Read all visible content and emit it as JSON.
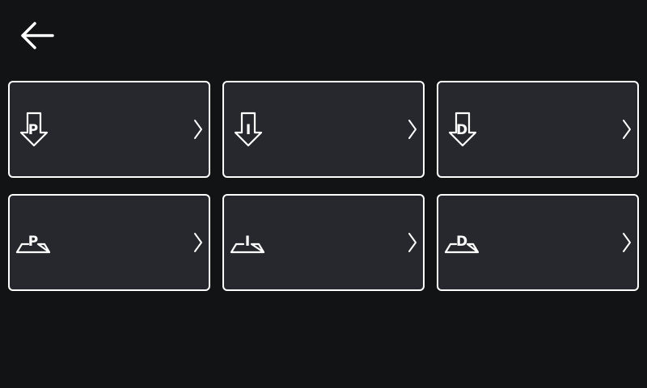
{
  "header": {
    "back_icon": "arrow-left-icon"
  },
  "tiles": [
    {
      "letter": "P",
      "icon": "arrow-down-p-icon",
      "chevron": "chevron-right-icon"
    },
    {
      "letter": "I",
      "icon": "arrow-down-i-icon",
      "chevron": "chevron-right-icon"
    },
    {
      "letter": "D",
      "icon": "arrow-down-d-icon",
      "chevron": "chevron-right-icon"
    },
    {
      "letter": "P",
      "icon": "platform-p-icon",
      "chevron": "chevron-right-icon"
    },
    {
      "letter": "I",
      "icon": "platform-i-icon",
      "chevron": "chevron-right-icon"
    },
    {
      "letter": "D",
      "icon": "platform-d-icon",
      "chevron": "chevron-right-icon"
    }
  ],
  "colors": {
    "background": "#121315",
    "tile_fill": "#27282d",
    "tile_border": "#ffffff",
    "foreground": "#ffffff"
  }
}
